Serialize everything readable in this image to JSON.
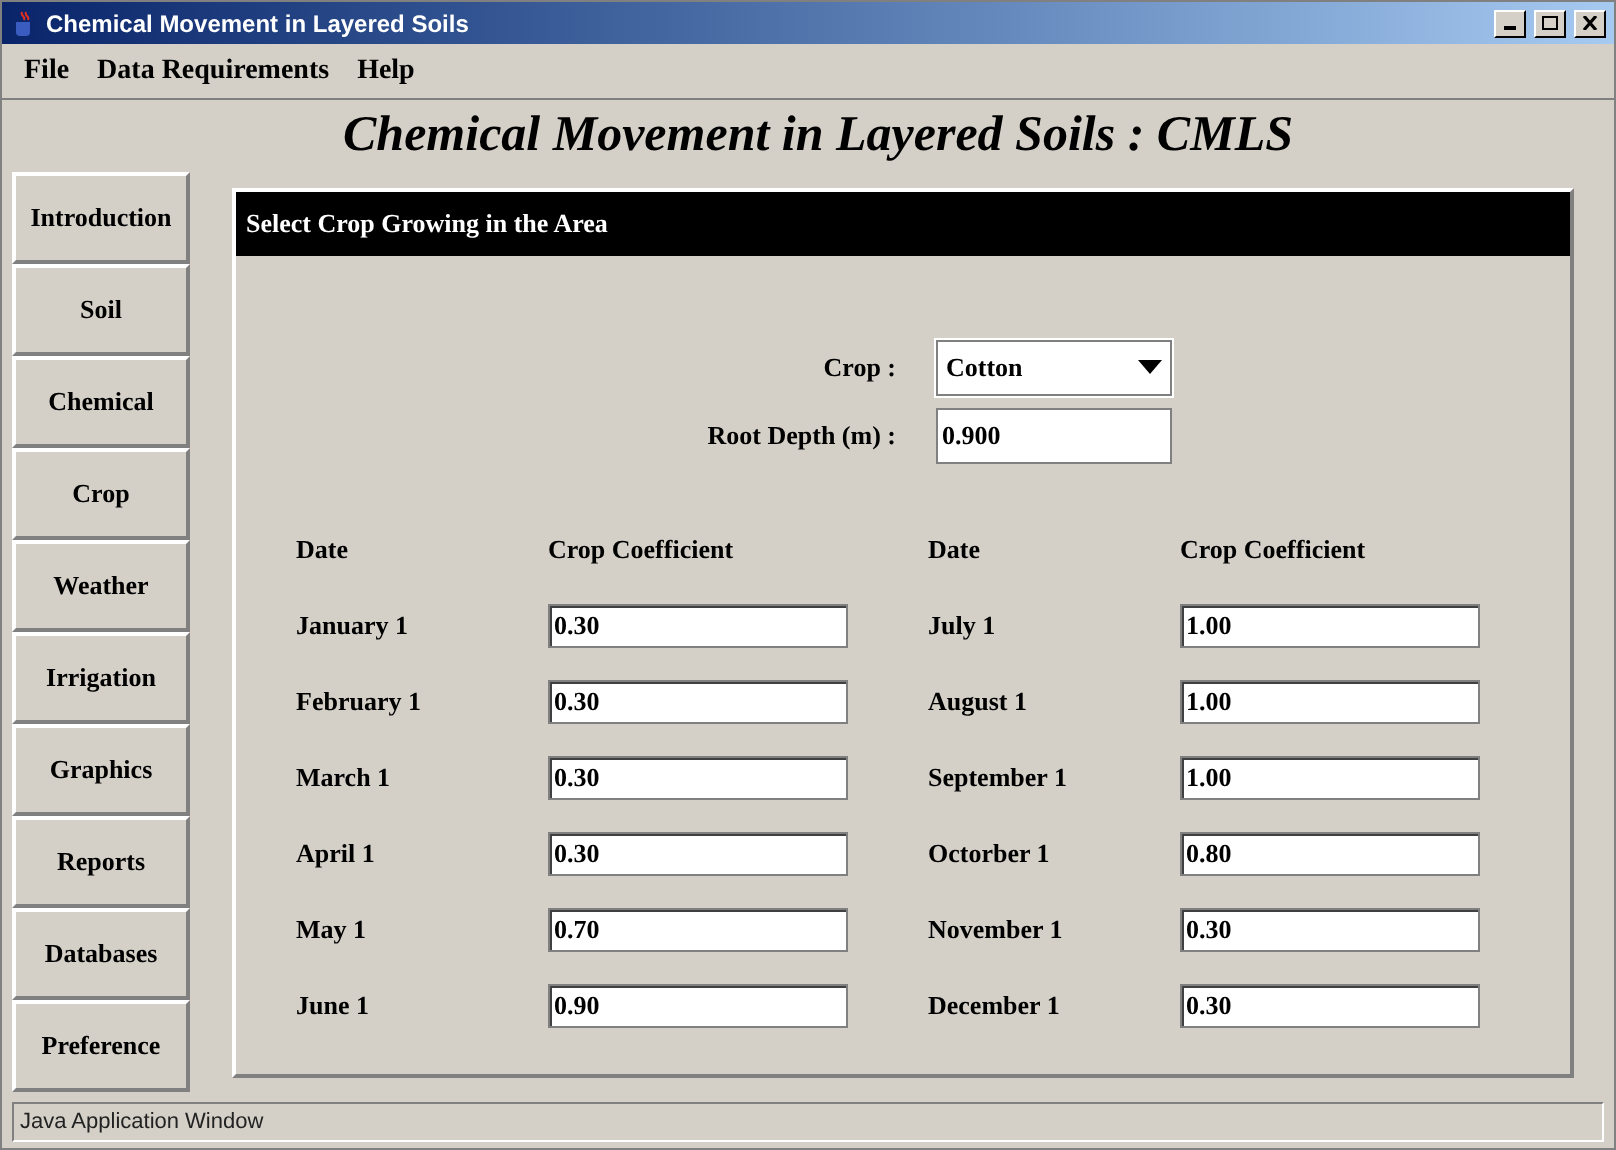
{
  "window": {
    "title": "Chemical Movement in Layered Soils"
  },
  "menu": [
    "File",
    "Data Requirements",
    "Help"
  ],
  "heading": "Chemical Movement in Layered Soils : CMLS",
  "sidebar": {
    "items": [
      "Introduction",
      "Soil",
      "Chemical",
      "Crop",
      "Weather",
      "Irrigation",
      "Graphics",
      "Reports",
      "Databases",
      "Preference"
    ]
  },
  "panel": {
    "title": "Select Crop Growing in the Area",
    "crop": {
      "label": "Crop :",
      "value": "Cotton"
    },
    "root_depth": {
      "label": "Root Depth (m) :",
      "value": "0.900"
    },
    "columns": [
      {
        "date_header": "Date",
        "coef_header": "Crop Coefficient",
        "rows": [
          {
            "date": "January 1",
            "value": "0.30"
          },
          {
            "date": "February 1",
            "value": "0.30"
          },
          {
            "date": "March 1",
            "value": "0.30"
          },
          {
            "date": "April 1",
            "value": "0.30"
          },
          {
            "date": "May 1",
            "value": "0.70"
          },
          {
            "date": "June 1",
            "value": "0.90"
          }
        ]
      },
      {
        "date_header": "Date",
        "coef_header": "Crop Coefficient",
        "rows": [
          {
            "date": "July 1",
            "value": "1.00"
          },
          {
            "date": "August 1",
            "value": "1.00"
          },
          {
            "date": "September 1",
            "value": "1.00"
          },
          {
            "date": "Octorber 1",
            "value": "0.80"
          },
          {
            "date": "November 1",
            "value": "0.30"
          },
          {
            "date": "December 1",
            "value": "0.30"
          }
        ]
      }
    ]
  },
  "status_bar": "Java Application Window"
}
